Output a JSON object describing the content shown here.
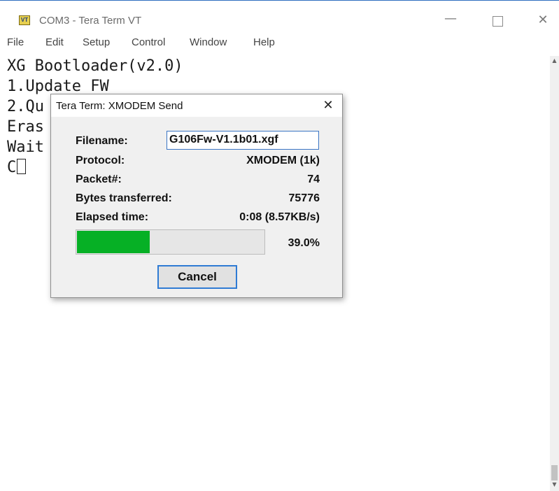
{
  "window": {
    "title": "COM3 - Tera Term VT",
    "app_icon": "VT",
    "controls": {
      "minimize": "—",
      "close": "✕"
    }
  },
  "menu": [
    "File",
    "Edit",
    "Setup",
    "Control",
    "Window",
    "Help"
  ],
  "terminal": {
    "lines": [
      "XG Bootloader(v2.0)",
      "1.Update FW",
      "2.Qu",
      "Eras",
      "Wait",
      "C"
    ]
  },
  "dialog": {
    "title": "Tera Term: XMODEM Send",
    "close": "✕",
    "filename_label": "Filename:",
    "filename_value": "G106Fw-V1.1b01.xgf",
    "protocol_label": "Protocol:",
    "protocol_value": "XMODEM (1k)",
    "packet_label": "Packet#:",
    "packet_value": "74",
    "bytes_label": "Bytes transferred:",
    "bytes_value": "75776",
    "elapsed_label": "Elapsed time:",
    "elapsed_value": "0:08 (8.57KB/s)",
    "progress_percent": 39.0,
    "progress_text": "39.0%",
    "cancel_label": "Cancel"
  },
  "colors": {
    "progress_fill": "#06b025",
    "focus_border": "#2f7bd4"
  }
}
